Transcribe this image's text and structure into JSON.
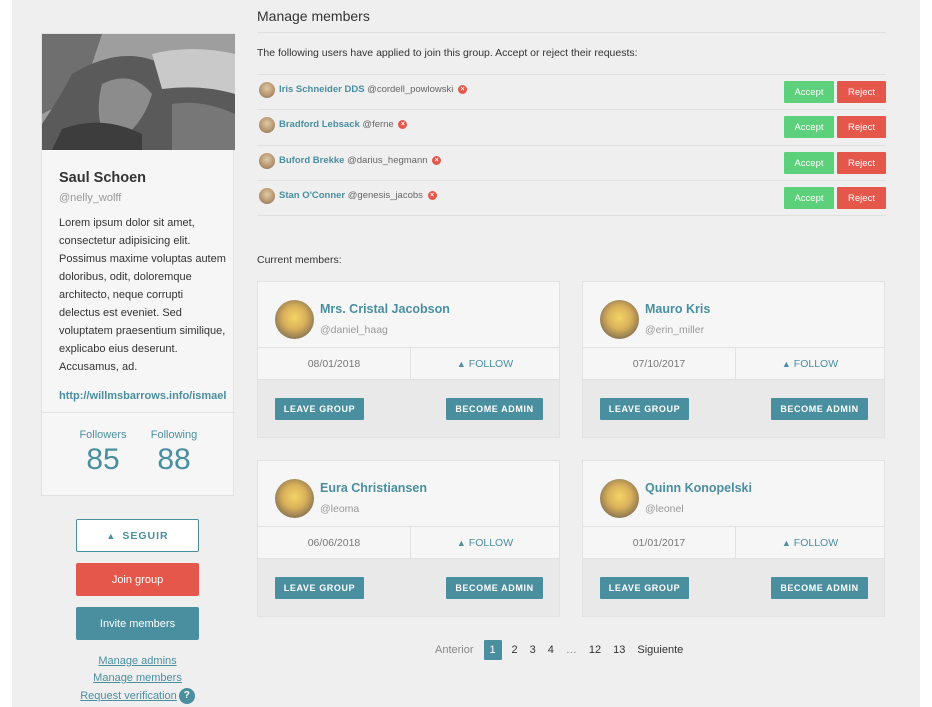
{
  "profile": {
    "name": "Saul Schoen",
    "handle": "@nelly_wolff",
    "bio": "Lorem ipsum dolor sit amet, consectetur adipisicing elit. Possimus maxime voluptas autem doloribus, odit, doloremque architecto, neque corrupti delectus est eveniet. Sed voluptatem praesentium similique, explicabo eius deserunt. Accusamus, ad.",
    "link": "http://willmsbarrows.info/ismael",
    "followers_label": "Followers",
    "followers_count": "85",
    "following_label": "Following",
    "following_count": "88"
  },
  "sidebar": {
    "follow_button": "SEGUIR",
    "join_button": "Join group",
    "invite_button": "Invite members",
    "manage_admins": "Manage admins",
    "manage_members": "Manage members",
    "request_verification": "Request verification",
    "help_glyph": "?"
  },
  "main": {
    "title": "Manage members",
    "intro": "The following users have applied to join this group. Accept or reject their requests:",
    "requests": [
      {
        "name": "Iris Schneider DDS",
        "handle": "@cordell_powlowski"
      },
      {
        "name": "Bradford Lebsack",
        "handle": "@ferne"
      },
      {
        "name": "Buford Brekke",
        "handle": "@darius_hegmann"
      },
      {
        "name": "Stan O'Conner",
        "handle": "@genesis_jacobs"
      }
    ],
    "accept_label": "Accept",
    "reject_label": "Reject",
    "current_members_label": "Current members:",
    "members": [
      {
        "name": "Mrs. Cristal Jacobson",
        "handle": "@daniel_haag",
        "date": "08/01/2018"
      },
      {
        "name": "Mauro Kris",
        "handle": "@erin_miller",
        "date": "07/10/2017"
      },
      {
        "name": "Eura Christiansen",
        "handle": "@leoma",
        "date": "06/06/2018"
      },
      {
        "name": "Quinn Konopelski",
        "handle": "@leonel",
        "date": "01/01/2017"
      }
    ],
    "follow_label": "FOLLOW",
    "leave_label": "LEAVE GROUP",
    "admin_label": "BECOME ADMIN"
  },
  "pagination": {
    "prev": "Anterior",
    "pages": [
      "1",
      "2",
      "3",
      "4",
      "…",
      "12",
      "13"
    ],
    "current": "1",
    "next": "Siguiente"
  },
  "colors": {
    "accent": "#4a8fa0",
    "danger": "#e5574b",
    "success": "#5cd07a"
  },
  "icons": {
    "follow": "bell-icon",
    "remove": "remove-icon",
    "help": "help-icon"
  }
}
